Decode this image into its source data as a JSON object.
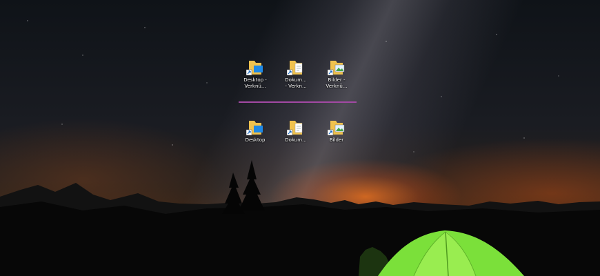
{
  "desktop": {
    "shortcuts_row": [
      {
        "label": "Desktop -\nVerknü...",
        "kind": "desktop",
        "shortcut": true
      },
      {
        "label": "Dokum...\n- Verkn...",
        "kind": "documents",
        "shortcut": true
      },
      {
        "label": "Bilder -\nVerknü...",
        "kind": "pictures",
        "shortcut": true
      }
    ],
    "folders_row": [
      {
        "label": "Desktop",
        "kind": "desktop",
        "shortcut": true
      },
      {
        "label": "Dokum...",
        "kind": "documents",
        "shortcut": true
      },
      {
        "label": "Bilder",
        "kind": "pictures",
        "shortcut": true
      }
    ],
    "divider_color": "#a349a4",
    "tent_color": "#7be03a"
  }
}
